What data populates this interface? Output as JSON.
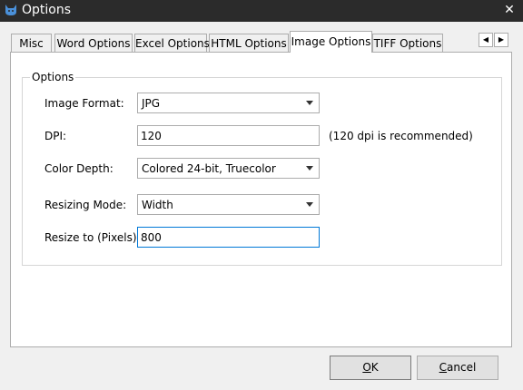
{
  "window": {
    "title": "Options",
    "close_glyph": "✕"
  },
  "icons": {
    "app": "cat-head-icon",
    "close": "close-icon",
    "scroll_left": "triangle-left-icon",
    "scroll_right": "triangle-right-icon",
    "dropdown": "chevron-down-icon"
  },
  "colors": {
    "titlebar": "#2b2b2b",
    "app_icon": "#4a90d9",
    "focus_border": "#0078d7"
  },
  "tabs": [
    {
      "label": "Misc"
    },
    {
      "label": "Word Options"
    },
    {
      "label": "Excel Options"
    },
    {
      "label": "HTML Options"
    },
    {
      "label": "Image Options",
      "active": true
    },
    {
      "label": "TIFF Options"
    }
  ],
  "tab_scroll": {
    "left_glyph": "◀",
    "right_glyph": "▶"
  },
  "group": {
    "legend": "Options"
  },
  "fields": {
    "image_format": {
      "label": "Image Format:",
      "value": "JPG"
    },
    "dpi": {
      "label": "DPI:",
      "value": "120",
      "hint": "(120 dpi is recommended)"
    },
    "color_depth": {
      "label": "Color Depth:",
      "value": "Colored 24-bit, Truecolor"
    },
    "resizing_mode": {
      "label": "Resizing Mode:",
      "value": "Width"
    },
    "resize_to": {
      "label": "Resize to (Pixels):",
      "value": "800"
    }
  },
  "buttons": {
    "ok": {
      "mnemonic": "O",
      "rest": "K"
    },
    "cancel": {
      "mnemonic": "C",
      "rest": "ancel"
    }
  }
}
